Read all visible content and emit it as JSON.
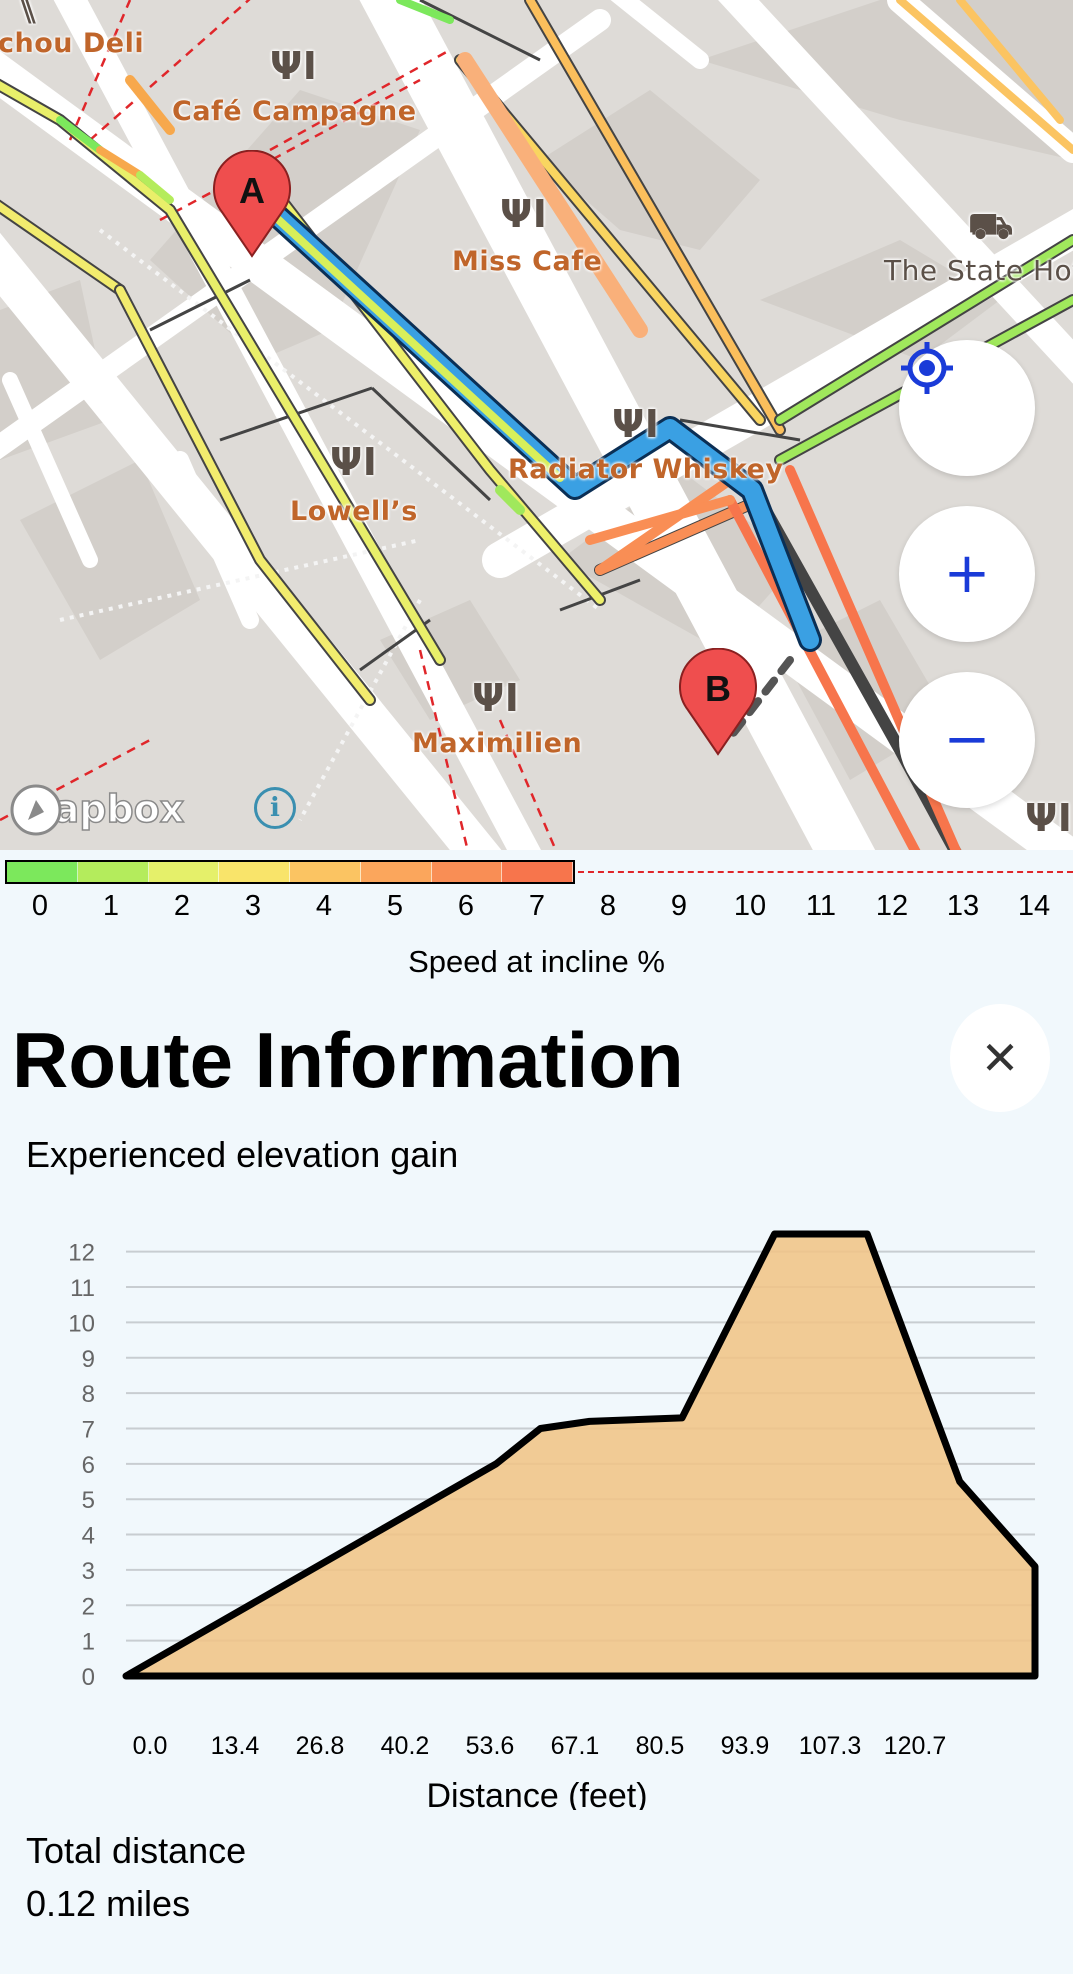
{
  "map": {
    "labels": {
      "chou_deli": "chou Deli",
      "cafe_campagne": "Café Campagne",
      "miss_cafe": "Miss Cafe",
      "state_hotel": "The State Hot",
      "radiator": "Radiator Whiskey",
      "lowells": "Lowell’s",
      "maximilien": "Maximilien"
    },
    "markers": {
      "start": "A",
      "end": "B"
    },
    "attribution": "mapbox",
    "info": "i",
    "controls": {
      "locate": "locate-icon",
      "zoom_in": "+",
      "zoom_out": "−"
    }
  },
  "legend": {
    "colors": [
      "#7ce85c",
      "#b4ec5c",
      "#e5f06a",
      "#f9e46a",
      "#fbc462",
      "#fba65c",
      "#f98e55",
      "#f7754c"
    ],
    "ticks": [
      "0",
      "1",
      "2",
      "3",
      "4",
      "5",
      "6",
      "7",
      "8",
      "9",
      "10",
      "11",
      "12",
      "13",
      "14"
    ],
    "title": "Speed at incline %"
  },
  "panel": {
    "title": "Route Information",
    "close": "✕",
    "elevation_label": "Experienced elevation gain",
    "total_label": "Total distance",
    "total_value": "0.12 miles"
  },
  "chart_data": {
    "type": "area",
    "x": [
      0,
      53.6,
      60,
      67.1,
      80.5,
      93.9,
      107.3,
      120.7,
      131.6
    ],
    "y": [
      0,
      6,
      7,
      7.2,
      7.3,
      12.5,
      12.5,
      5.5,
      3.1
    ],
    "fill_color": "#f0c486",
    "line_color": "#000000",
    "ylim": [
      0,
      12.5
    ],
    "yticks": [
      "0",
      "1",
      "2",
      "3",
      "4",
      "5",
      "6",
      "7",
      "8",
      "9",
      "10",
      "11",
      "12"
    ],
    "xticks": [
      "0.0",
      "13.4",
      "26.8",
      "40.2",
      "53.6",
      "67.1",
      "80.5",
      "93.9",
      "107.3",
      "120.7"
    ],
    "xlabel": "Distance (feet)",
    "ylabel": "",
    "grid": true
  }
}
